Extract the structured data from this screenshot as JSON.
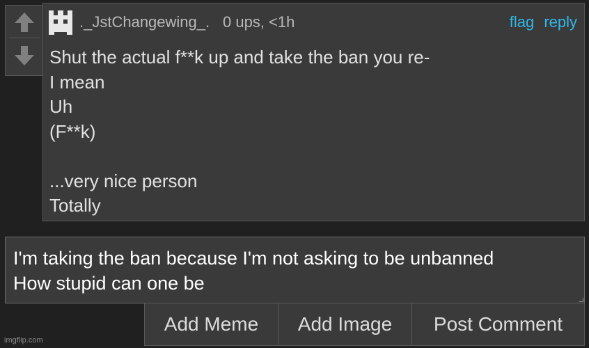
{
  "comment": {
    "username": "._JstChangewing_.",
    "meta": "0 ups, <1h",
    "flag_label": "flag",
    "reply_label": "reply",
    "lines": [
      "Shut the actual f**k up and take the ban you re-",
      "I mean",
      "Uh",
      "(F**k)",
      "",
      "...very nice person",
      "Totally"
    ]
  },
  "reply_box": {
    "lines": [
      "I'm taking the ban because I'm not asking to be unbanned",
      "How stupid can one be"
    ]
  },
  "buttons": {
    "add_meme": "Add Meme",
    "add_image": "Add Image",
    "post_comment": "Post Comment"
  },
  "watermark": "imgflip.com",
  "icons": {
    "upvote": "arrow-up-icon",
    "downvote": "arrow-down-icon",
    "avatar": "pixel-face-avatar"
  },
  "colors": {
    "link": "#2fb9ea",
    "panel": "#3a3a3a",
    "background": "#202020"
  }
}
